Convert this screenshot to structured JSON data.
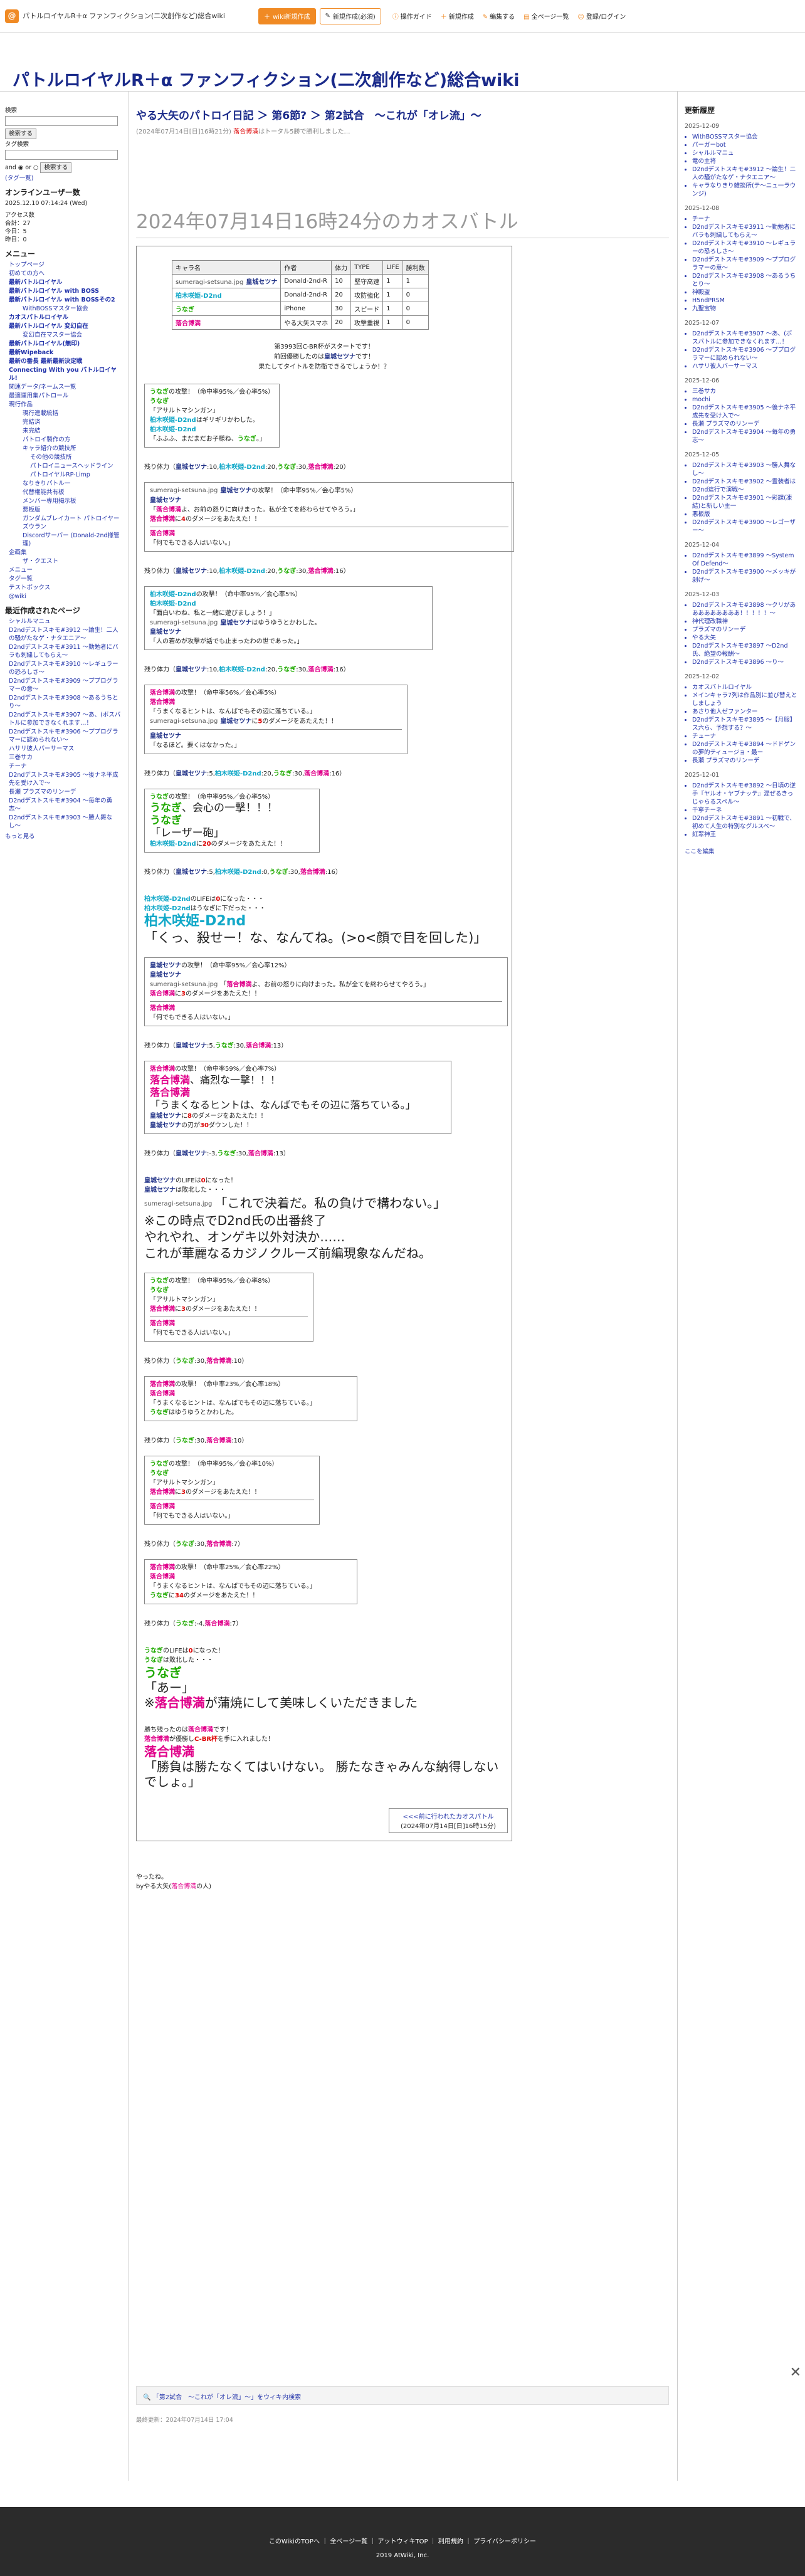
{
  "header": {
    "title": "パトルロイヤルR＋α ファンフィクション(二次創作など)総合wiki",
    "btn1": "wiki新規作成",
    "btn2": "新規作成(必須)",
    "nav": [
      "操作ガイド",
      "新規作成",
      "編集する",
      "全ページ一覧",
      "登録/ログイン"
    ]
  },
  "site_title": "パトルロイヤルR＋α ファンフィクション(二次創作など)総合wiki",
  "left": {
    "search_label": "検索",
    "search_btn": "検索する",
    "tag_label": "タグ検索",
    "and": "and",
    "or": "or",
    "tag_btn": "検索する",
    "tag_list": "(タグ一覧)",
    "online_title": "オンラインユーザー数",
    "online_time": "2025.12.10 07:14:24 (Wed)",
    "stats": [
      "アクセス数",
      "合計：27",
      "今日：5",
      "昨日：0"
    ],
    "menu_title": "メニュー",
    "menu": [
      {
        "t": "トップページ",
        "c": ""
      },
      {
        "t": "初めての方へ",
        "c": ""
      },
      {
        "t": "最新パトルロイヤル",
        "c": "b"
      },
      {
        "t": "最新パトルロイヤル with BOSS",
        "c": "b"
      },
      {
        "t": "最新パトルロイヤル with BOSSその2",
        "c": "b"
      },
      {
        "t": "WithBOSSマスター協会",
        "c": "s"
      },
      {
        "t": "カオスパトルロイヤル",
        "c": "b"
      },
      {
        "t": "最新パトルロイヤル 変幻自在",
        "c": "b"
      },
      {
        "t": "変幻自在マスター協会",
        "c": "s"
      },
      {
        "t": "最新パトルロイヤル(無印)",
        "c": "b"
      },
      {
        "t": "最新Wipeback",
        "c": "b"
      },
      {
        "t": "最新の番長 最新最新決定戦",
        "c": "b"
      },
      {
        "t": "Connecting With you パトルロイヤル!",
        "c": "b"
      },
      {
        "t": "関連データ/ネームス一覧",
        "c": ""
      },
      {
        "t": "最適運用集パトロール",
        "c": ""
      },
      {
        "t": "現行作品",
        "c": ""
      },
      {
        "t": "現行連載統括",
        "c": "s"
      },
      {
        "t": "完結済",
        "c": "s"
      },
      {
        "t": "未完結",
        "c": "s"
      },
      {
        "t": "パトロイ製作の方",
        "c": "s"
      },
      {
        "t": "キャラ紹介の競技所",
        "c": "s"
      },
      {
        "t": "その他の競技所",
        "c": "ss"
      },
      {
        "t": "パトロイニュースへッドライン",
        "c": "ss"
      },
      {
        "t": "パトロイヤルRP-Limp",
        "c": "ss"
      },
      {
        "t": "なりきりパトル一",
        "c": "s"
      },
      {
        "t": "代替権能共有板",
        "c": "s"
      },
      {
        "t": "メンバー専用掲示板",
        "c": "s"
      },
      {
        "t": "悪板版",
        "c": "s"
      },
      {
        "t": "ガンダムブレイカート パトロイヤーズウラン",
        "c": "s"
      },
      {
        "t": "Discordサーバー (Donald-2nd様管理)",
        "c": "s"
      },
      {
        "t": "企画集",
        "c": ""
      },
      {
        "t": "ザ・クエスト",
        "c": "s"
      },
      {
        "t": "メニュー",
        "c": ""
      },
      {
        "t": "タグ一覧",
        "c": ""
      },
      {
        "t": "テストボックス",
        "c": ""
      },
      {
        "t": "@wiki",
        "c": ""
      }
    ],
    "recent_title": "最近作成されたページ",
    "recent": [
      "シャルルマニュ",
      "D2ndデストスキモ#3912 〜論生！二人の騒がたなゲ・ナタエニア〜",
      "D2ndデストスキモ#3911 〜勤勉者にバラも刺繍してもらえ〜",
      "D2ndデストスキモ#3910 〜レギュラーの恐ろしさ〜",
      "D2ndデストスキモ#3909 〜ププログラマーの意〜",
      "D2ndデストスキモ#3908 〜あるうちとり〜",
      "D2ndデストスキモ#3907 〜あ、(ボスバトルに参加できなくれます…！",
      "D2ndデストスキモ#3906 〜ププログラマーに認められない〜",
      "ハサリ彼人バーサーマス",
      "三巻サカ",
      "チーナ",
      "D2ndデストスキモ#3905 〜後ナネ平成先を受け入で〜",
      "長瀬 プラズマのリンーデ",
      "D2ndデストスキモ#3904 〜毎年の勇志〜",
      "D2ndデストスキモ#3903 〜勝人舞なし〜"
    ],
    "more": "もっと見る"
  },
  "main": {
    "breadcrumb": "やる大矢のパトロイ日記 ＞ 第6節? ＞ 第2試合　〜これが「オレ流」〜",
    "meta_date": "(2024年07月14日[日]16時21分)",
    "meta_author": "落合博満",
    "meta_rest": "はトータル5勝で勝利しました…",
    "big_title": "2024年07月14日16時24分のカオスバトル",
    "table_head": [
      "キャラ名",
      "作者",
      "体力",
      "TYPE",
      "LIFE",
      "勝利数"
    ],
    "table_rows": [
      [
        "皇城セツナ",
        "Donald-2nd-R",
        "10",
        "堅守高速",
        "1",
        "1"
      ],
      [
        "柏木咲姫-D2nd",
        "Donald-2nd-R",
        "20",
        "攻防強化",
        "1",
        "0"
      ],
      [
        "うなぎ",
        "iPhone",
        "30",
        "スピード",
        "1",
        "0"
      ],
      [
        "落合博満",
        "やる大矢スマホ",
        "20",
        "攻撃重視",
        "1",
        "0"
      ]
    ],
    "img_alt": "sumeragi-setsuna.jpg",
    "intro1": "第3993回C-BR杯がスタートです！",
    "intro2a": "前回優勝したのは",
    "intro2b": "皇城セツナ",
    "intro2c": "です！",
    "intro3": "果たしてタイトルを防衛できるでしょうか！？",
    "stamina_label": "残り体力",
    "final_a": "<<<前に行われたカオスパトル",
    "final_b": "(2024年07月14日[日]16時15分)",
    "closing1": "やったね。",
    "closing2a": "byやる大矢(",
    "closing2b": "落合博満",
    "closing2c": "の人)",
    "share": "「第2試合　〜これが「オレ流」〜」をウィキ内検索",
    "last_updated": "最終更新：2024年07月14日 17:04"
  },
  "right": {
    "title": "更新履歴",
    "groups": [
      {
        "d": "2025-12-09",
        "i": [
          "WithBOSSマスター協会",
          "パーガーbot",
          "シャルルマニュ",
          "竜の主将",
          "D2ndデストスキモ#3912 〜論生！二人の騒がたなゲ・ナタエニア〜",
          "キャラなりきり雑談所(テ〜ニュ一ラウンジ)"
        ]
      },
      {
        "d": "2025-12-08",
        "i": [
          "チーナ",
          "D2ndデストスキモ#3911 〜勤勉者にバラも刺繍してもらえ〜",
          "D2ndデストスキモ#3910 〜レギュラーの恐ろしさ〜",
          "D2ndデストスキモ#3909 〜ププログラマーの意〜",
          "D2ndデストスキモ#3908 〜あるうちとり〜",
          "神殿盗",
          "H5ndPRSM",
          "九聖宝物"
        ]
      },
      {
        "d": "2025-12-07",
        "i": [
          "D2ndデストスキモ#3907 〜あ、(ボスバトルに参加できなくれます…！",
          "D2ndデストスキモ#3906 〜ププログラマーに認められない〜",
          "ハサリ彼人バーサーマス"
        ]
      },
      {
        "d": "2025-12-06",
        "i": [
          "三巻サカ",
          "mochi",
          "D2ndデストスキモ#3905 〜後ナネ平成先を受け入で〜",
          "長瀬 プラズマのリンーデ",
          "D2ndデストスキモ#3904 〜毎年の勇志〜"
        ]
      },
      {
        "d": "2025-12-05",
        "i": [
          "D2ndデストスキモ#3903 〜勝人舞なし〜",
          "D2ndデストスキモ#3902 〜霊装者はD2nd這行で演戦〜",
          "D2ndデストスキモ#3901 〜彩課(凍結)と新しい主一",
          "悪板版",
          "D2ndデストスキモ#3900 〜レゴーザー〜"
        ]
      },
      {
        "d": "2025-12-04",
        "i": [
          "D2ndデストスキモ#3899 〜System Of Defend〜",
          "D2ndデストスキモ#3900 〜メッキが剥げ〜"
        ]
      },
      {
        "d": "2025-12-03",
        "i": [
          "D2ndデストスキモ#3898 〜クリがあああああああああ！！！！！〜",
          "神代理改職神",
          "プラズマのリンーデ",
          "やる大矢",
          "D2ndデストスキモ#3897 〜D2nd氏、絶望の報酬〜",
          "D2ndデストスキモ#3896 〜り〜"
        ]
      },
      {
        "d": "2025-12-02",
        "i": [
          "カオスパトルロイヤル",
          "メインキャラ7列は作品別に並び替えとしましょう",
          "あさり他人ゼファンター",
          "D2ndデストスキモ#3895 〜【月服】ス六ら、予想する？〜",
          "チューナ",
          "D2ndデストスキモ#3894 〜ドドゲンの夢的ティュージョ・最ー",
          "長瀬 プラズマのリンーデ"
        ]
      },
      {
        "d": "2025-12-01",
        "i": [
          "D2ndデストスキモ#3892 〜日頃の逆手『ヤルオ・ヤブナッテ』混ぜるきっじゃらるスペル〜",
          "千寧チーネ",
          "D2ndデストスキモ#3891 〜初戦で、初めて人生の特別なグルスベ〜",
          "紅翠神王"
        ]
      }
    ],
    "more": "ここを編集"
  },
  "footer": {
    "links": [
      "このWikiのTOPへ",
      "全ページ一覧",
      "アットウィキTOP",
      "利用規約",
      "プライバシーポリシー"
    ],
    "copyright": "2019 AtWiki, Inc."
  }
}
